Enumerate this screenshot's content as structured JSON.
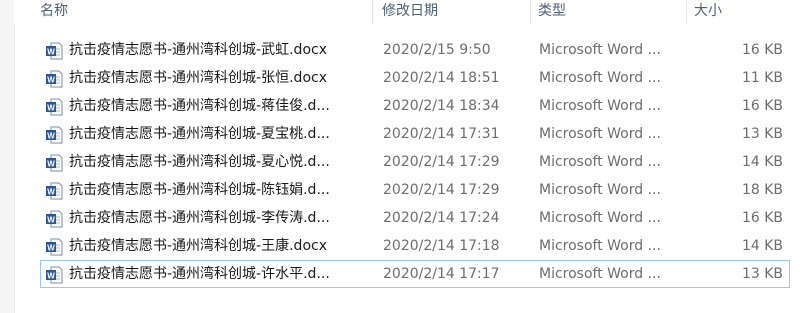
{
  "columns": {
    "name": "名称",
    "date": "修改日期",
    "type": "类型",
    "size": "大小"
  },
  "files": [
    {
      "name": "抗击疫情志愿书-通州湾科创城-武虹.docx",
      "date": "2020/2/15 9:50",
      "type": "Microsoft Word ...",
      "size": "16 KB"
    },
    {
      "name": "抗击疫情志愿书-通州湾科创城-张恒.docx",
      "date": "2020/2/14 18:51",
      "type": "Microsoft Word ...",
      "size": "11 KB"
    },
    {
      "name": "抗击疫情志愿书-通州湾科创城-蒋佳俊.d...",
      "date": "2020/2/14 18:34",
      "type": "Microsoft Word ...",
      "size": "16 KB"
    },
    {
      "name": "抗击疫情志愿书-通州湾科创城-夏宝桃.d...",
      "date": "2020/2/14 17:31",
      "type": "Microsoft Word ...",
      "size": "13 KB"
    },
    {
      "name": "抗击疫情志愿书-通州湾科创城-夏心悦.d...",
      "date": "2020/2/14 17:29",
      "type": "Microsoft Word ...",
      "size": "14 KB"
    },
    {
      "name": "抗击疫情志愿书-通州湾科创城-陈钰娟.d...",
      "date": "2020/2/14 17:29",
      "type": "Microsoft Word ...",
      "size": "18 KB"
    },
    {
      "name": "抗击疫情志愿书-通州湾科创城-李传涛.d...",
      "date": "2020/2/14 17:24",
      "type": "Microsoft Word ...",
      "size": "16 KB"
    },
    {
      "name": "抗击疫情志愿书-通州湾科创城-王康.docx",
      "date": "2020/2/14 17:18",
      "type": "Microsoft Word ...",
      "size": "14 KB"
    },
    {
      "name": "抗击疫情志愿书-通州湾科创城-许水平.d...",
      "date": "2020/2/14 17:17",
      "type": "Microsoft Word ...",
      "size": "13 KB"
    }
  ],
  "icons": {
    "file_icon": "word-document-icon"
  },
  "colors": {
    "header_text": "#4c607a",
    "focus_border": "#99c9ef",
    "word_blue": "#2b579a"
  }
}
